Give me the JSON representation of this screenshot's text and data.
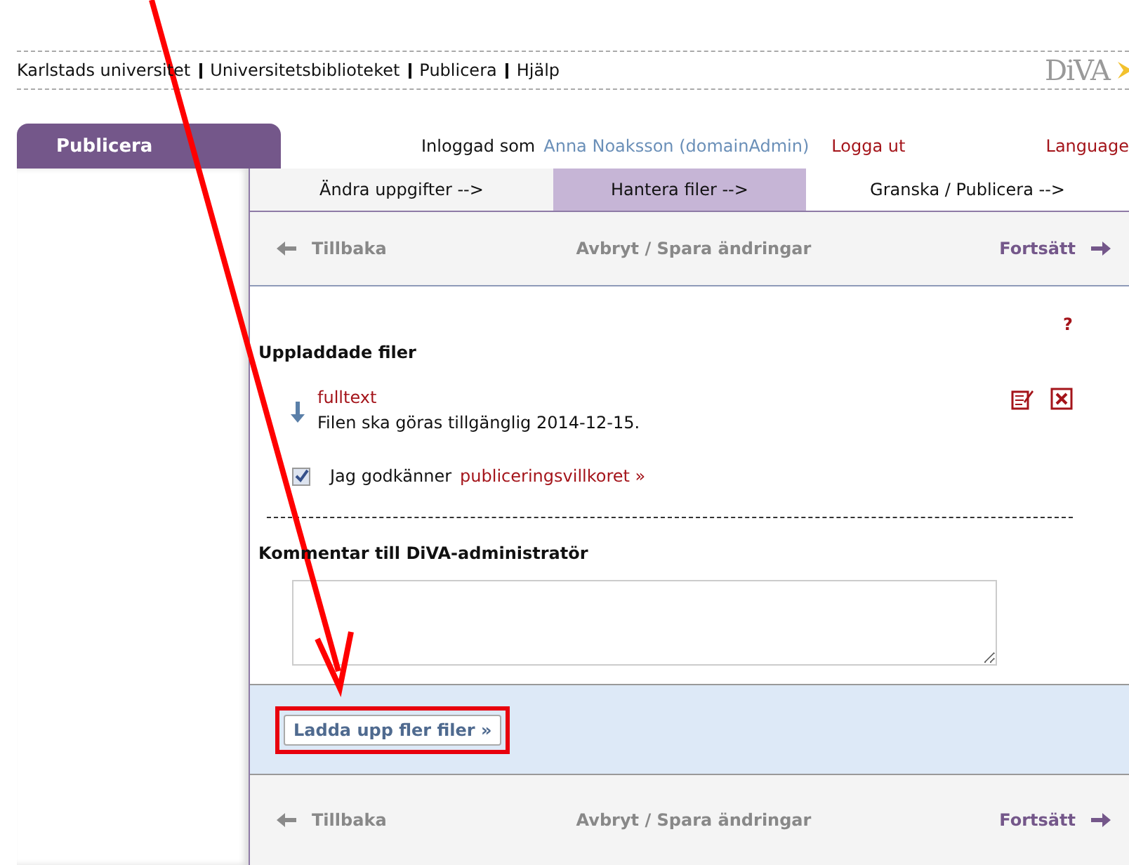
{
  "top_nav": {
    "links": [
      "Karlstads universitet",
      "Universitetsbiblioteket",
      "Publicera",
      "Hjälp"
    ],
    "logo": "DiVA"
  },
  "main_tab": {
    "label": "Publicera"
  },
  "user_bar": {
    "label": "Inloggad som",
    "user": "Anna Noaksson (domainAdmin)",
    "logout": "Logga ut",
    "language": "Language"
  },
  "steps": [
    {
      "label": "Ändra uppgifter -->",
      "selected": false
    },
    {
      "label": "Hantera filer -->",
      "selected": true
    },
    {
      "label": "Granska / Publicera -->",
      "selected": false
    }
  ],
  "nav_top": {
    "back": "Tillbaka",
    "cancel_save": "Avbryt / Spara ändringar",
    "next": "Fortsätt"
  },
  "help": "?",
  "section_title": "Uppladdade filer",
  "files": [
    {
      "name": "fulltext",
      "note": "Filen ska göras tillgänglig 2014-12-15."
    }
  ],
  "agreement": {
    "checked": true,
    "text": "Jag godkänner",
    "link": "publiceringsvillkoret »"
  },
  "comment": {
    "label": "Kommentar till DiVA-administratör"
  },
  "upload_button": "Ladda upp fler filer »",
  "nav_bottom": {
    "back": "Tillbaka",
    "cancel_save": "Avbryt / Spara ändringar",
    "next": "Fortsätt"
  }
}
